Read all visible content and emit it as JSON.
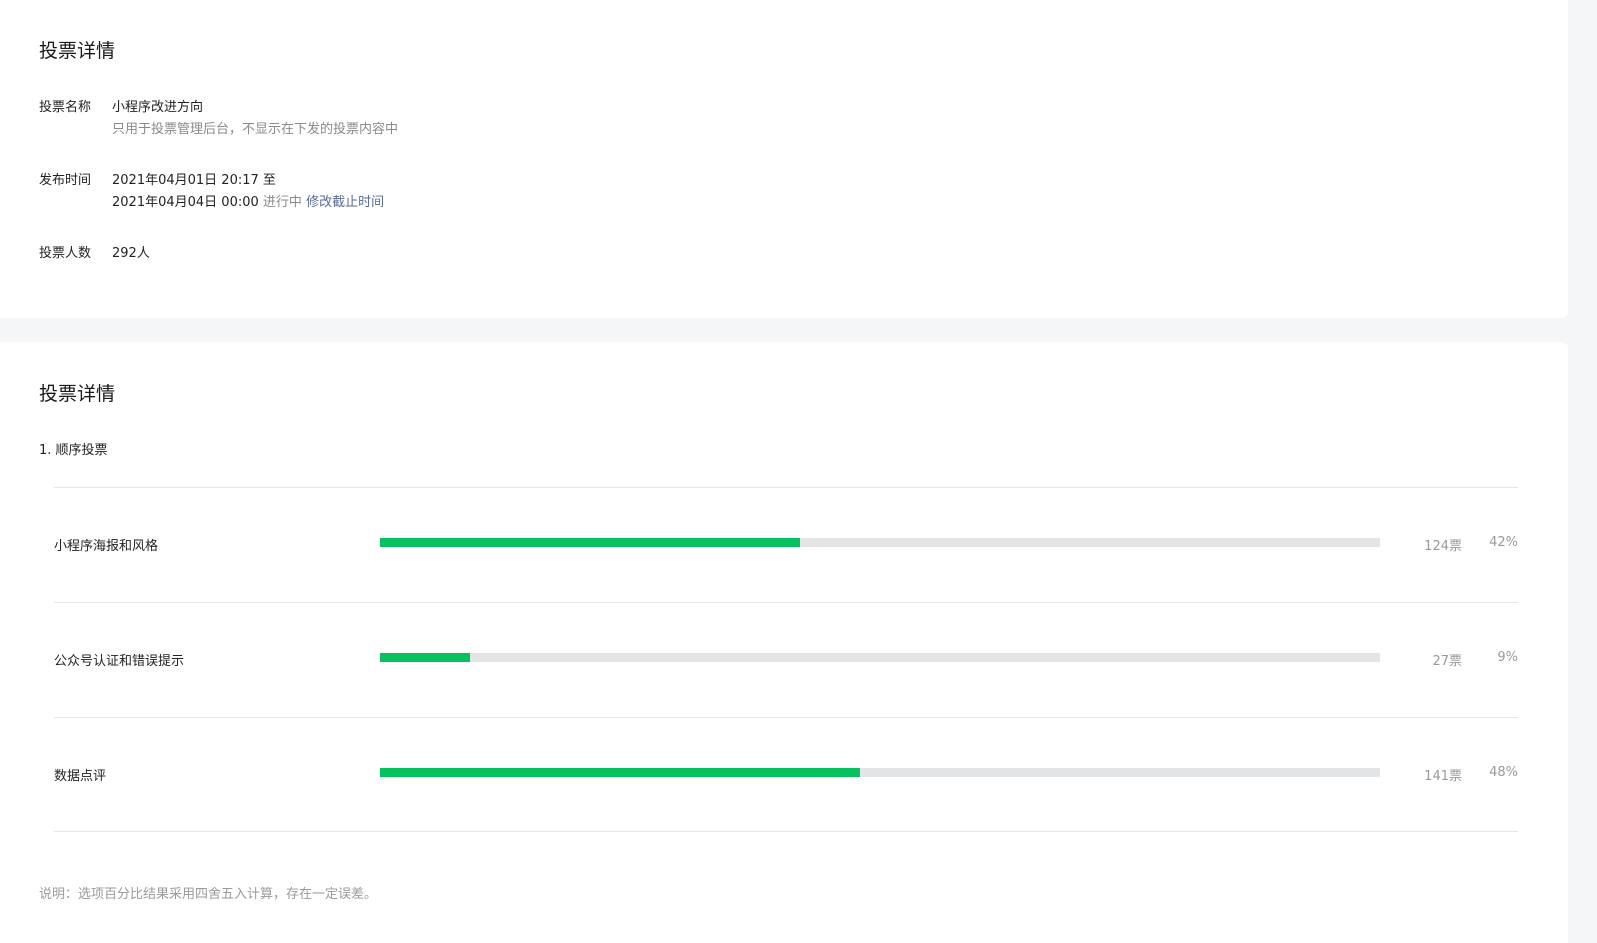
{
  "info_card": {
    "title": "投票详情",
    "name_label": "投票名称",
    "name_value": "小程序改进方向",
    "name_hint": "只用于投票管理后台，不显示在下发的投票内容中",
    "time_label": "发布时间",
    "time_start": "2021年04月01日 20:17 至",
    "time_end": "2021年04月04日 00:00",
    "status": "进行中",
    "modify_link": "修改截止时间",
    "count_label": "投票人数",
    "count_value": "292人"
  },
  "results_card": {
    "title": "投票详情",
    "question": "1. 顺序投票",
    "options": [
      {
        "label": "小程序海报和风格",
        "votes": "124票",
        "percent": "42%",
        "fraction": 0.42
      },
      {
        "label": "公众号认证和错误提示",
        "votes": "27票",
        "percent": "9%",
        "fraction": 0.09
      },
      {
        "label": "数据点评",
        "votes": "141票",
        "percent": "48%",
        "fraction": 0.48
      }
    ],
    "footnote": "说明：选项百分比结果采用四舍五入计算，存在一定误差。"
  },
  "colors": {
    "accent": "#07c160",
    "track": "#e3e4e5",
    "link": "#576b95",
    "muted": "#8a8a8a",
    "background": "#f5f6f7"
  }
}
